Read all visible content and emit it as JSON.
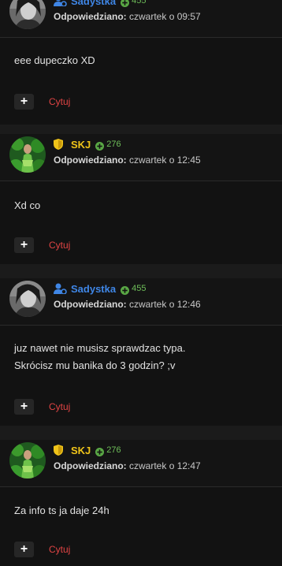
{
  "posts": [
    {
      "username": "Sadystka",
      "role": "member",
      "role_icon": "user-cog-icon",
      "rep": "455",
      "meta_label": "Odpowiedziano:",
      "meta_time": "czwartek o 09:57",
      "lines": [
        "eee dupeczko XD"
      ],
      "plus_label": "+",
      "quote_label": "Cytuj",
      "name_color": "#3f86e6"
    },
    {
      "username": "SKJ",
      "role": "moderator",
      "role_icon": "shield-icon",
      "rep": "276",
      "meta_label": "Odpowiedziano:",
      "meta_time": "czwartek o 12:45",
      "lines": [
        "Xd co"
      ],
      "plus_label": "+",
      "quote_label": "Cytuj",
      "name_color": "#f0c419"
    },
    {
      "username": "Sadystka",
      "role": "member",
      "role_icon": "user-cog-icon",
      "rep": "455",
      "meta_label": "Odpowiedziano:",
      "meta_time": "czwartek o 12:46",
      "lines": [
        "juz nawet nie musisz sprawdzac typa.",
        "Skrócisz mu banika do 3 godzin? ;v"
      ],
      "plus_label": "+",
      "quote_label": "Cytuj",
      "name_color": "#3f86e6"
    },
    {
      "username": "SKJ",
      "role": "moderator",
      "role_icon": "shield-icon",
      "rep": "276",
      "meta_label": "Odpowiedziano:",
      "meta_time": "czwartek o 12:47",
      "lines": [
        "Za info ts ja daje 24h"
      ],
      "plus_label": "+",
      "quote_label": "Cytuj",
      "name_color": "#f0c419"
    }
  ]
}
